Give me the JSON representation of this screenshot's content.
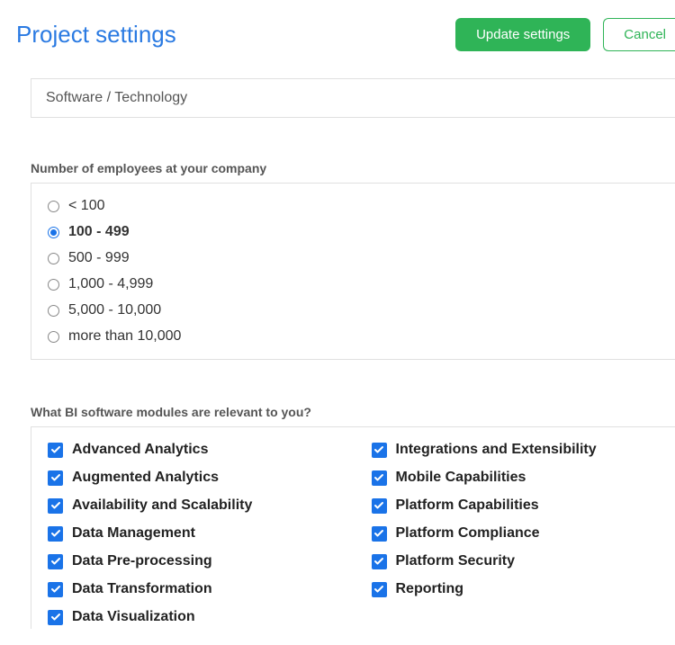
{
  "header": {
    "title": "Project settings",
    "update_label": "Update settings",
    "cancel_label": "Cancel"
  },
  "industry": {
    "selected": "Software / Technology"
  },
  "employees": {
    "label": "Number of employees at your company",
    "options": [
      {
        "label": "< 100",
        "selected": false
      },
      {
        "label": "100 - 499",
        "selected": true
      },
      {
        "label": "500 - 999",
        "selected": false
      },
      {
        "label": "1,000 - 4,999",
        "selected": false
      },
      {
        "label": "5,000 - 10,000",
        "selected": false
      },
      {
        "label": "more than 10,000",
        "selected": false
      }
    ]
  },
  "modules": {
    "label": "What BI software modules are relevant to you?",
    "left": [
      {
        "label": "Advanced Analytics",
        "checked": true
      },
      {
        "label": "Augmented Analytics",
        "checked": true
      },
      {
        "label": "Availability and Scalability",
        "checked": true
      },
      {
        "label": "Data Management",
        "checked": true
      },
      {
        "label": "Data Pre-processing",
        "checked": true
      },
      {
        "label": "Data Transformation",
        "checked": true
      },
      {
        "label": "Data Visualization",
        "checked": true
      }
    ],
    "right": [
      {
        "label": "Integrations and Extensibility",
        "checked": true
      },
      {
        "label": "Mobile Capabilities",
        "checked": true
      },
      {
        "label": "Platform Capabilities",
        "checked": true
      },
      {
        "label": "Platform Compliance",
        "checked": true
      },
      {
        "label": "Platform Security",
        "checked": true
      },
      {
        "label": "Reporting",
        "checked": true
      }
    ]
  }
}
